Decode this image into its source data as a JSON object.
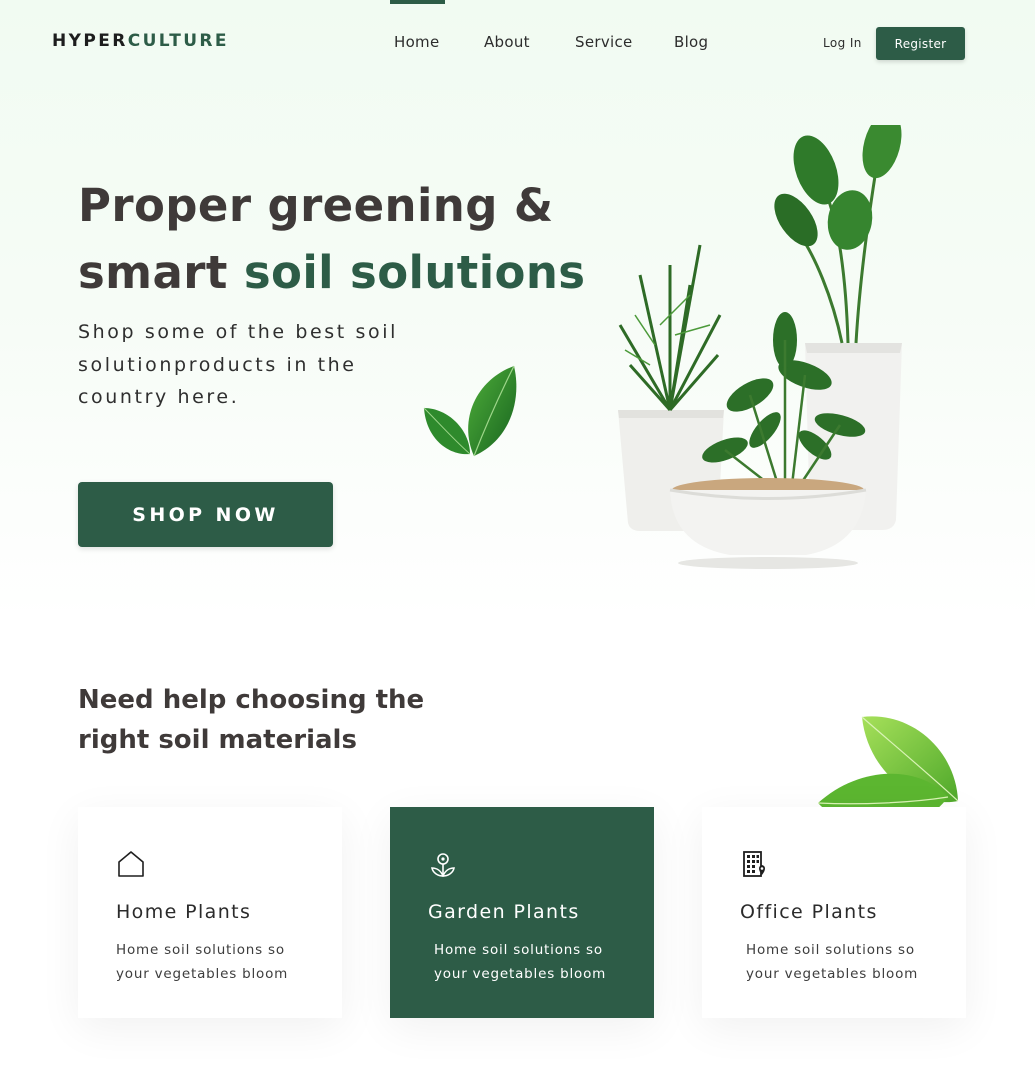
{
  "brand": {
    "logo_part1": "HYPER",
    "logo_part2": "CULTURE",
    "accent_color": "#2d5c47"
  },
  "nav": {
    "links": [
      "Home",
      "About",
      "Service",
      "Blog"
    ],
    "active": "Home",
    "login_label": "Log In",
    "register_label": "Register"
  },
  "hero": {
    "title_line1": "Proper greening &",
    "title_line2_plain": "smart ",
    "title_line2_green": "soil solutions",
    "subtitle": "Shop some of the best soil solutionproducts in the country here.",
    "cta_label": "SHOP NOW"
  },
  "help": {
    "title": "Need help choosing the right soil materials"
  },
  "cards": [
    {
      "title": "Home Plants",
      "description": "Home soil solutions so your vegetables bloom",
      "icon": "house-icon",
      "highlighted": false
    },
    {
      "title": "Garden Plants",
      "description": "Home soil solutions so your vegetables bloom",
      "icon": "flower-icon",
      "highlighted": true
    },
    {
      "title": "Office Plants",
      "description": "Home soil solutions so your vegetables bloom",
      "icon": "office-building-icon",
      "highlighted": false
    }
  ]
}
